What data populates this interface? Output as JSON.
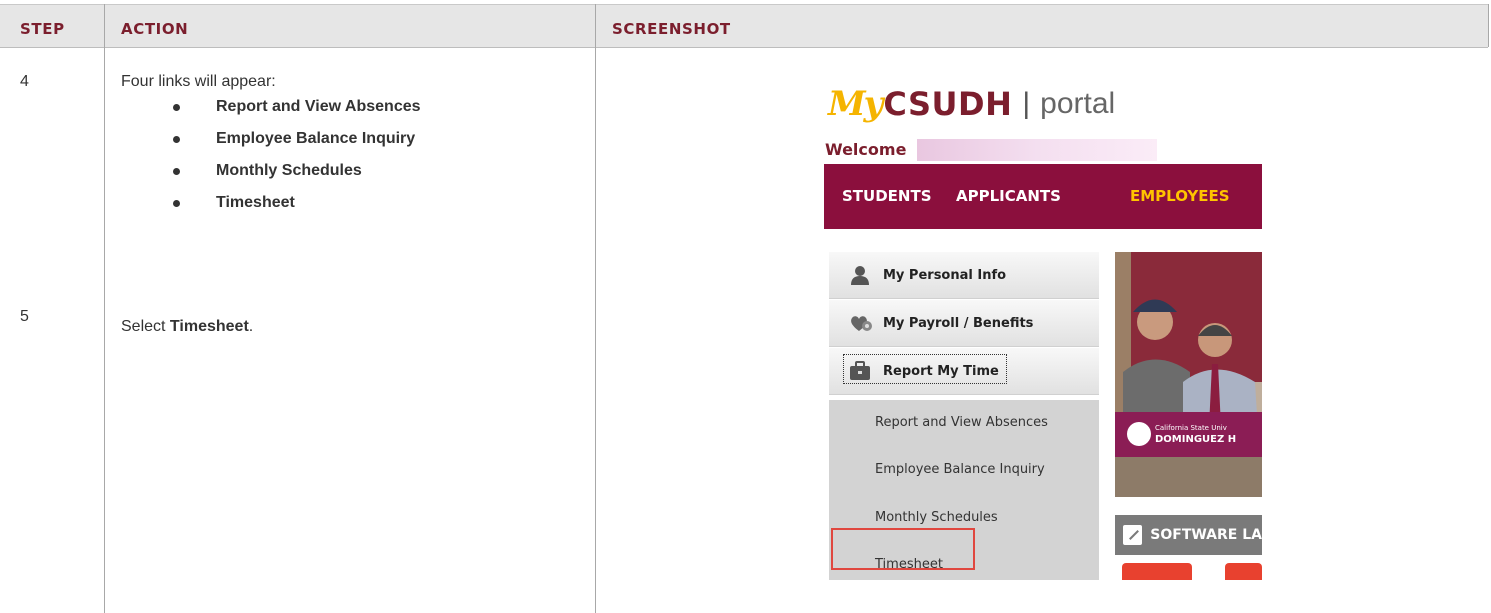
{
  "table": {
    "headers": [
      "STEP",
      "ACTION",
      "SCREENSHOT"
    ],
    "rows": [
      {
        "step": "4",
        "action_intro": "Four links will appear:",
        "bullets": [
          "Report and View Absences",
          "Employee Balance Inquiry",
          "Monthly Schedules",
          "Timesheet"
        ]
      },
      {
        "step": "5",
        "action_prefix": "Select ",
        "action_bold": "Timesheet",
        "action_suffix": "."
      }
    ]
  },
  "screenshot": {
    "logo": {
      "my": "My",
      "csudh": "CSUDH",
      "separator": "|",
      "portal": "portal"
    },
    "welcome": "Welcome",
    "nav": [
      "STUDENTS",
      "APPLICANTS",
      "EMPLOYEES"
    ],
    "nav_active": "EMPLOYEES",
    "sidebar": [
      {
        "label": "My Personal Info",
        "icon": "person-icon"
      },
      {
        "label": "My Payroll / Benefits",
        "icon": "payroll-icon"
      },
      {
        "label": "Report My Time",
        "icon": "briefcase-icon"
      }
    ],
    "submenu": [
      "Report and View Absences",
      "Employee Balance Inquiry",
      "Monthly Schedules",
      "Timesheet"
    ],
    "highlighted_item": "Timesheet",
    "banner": {
      "prefix": "California State Univ",
      "name": "DOMINGUEZ H"
    },
    "software_tile": "SOFTWARE LA",
    "colors": {
      "maroon": "#8b0f3d",
      "gold": "#ffc400",
      "highlight": "#e0473f"
    }
  }
}
